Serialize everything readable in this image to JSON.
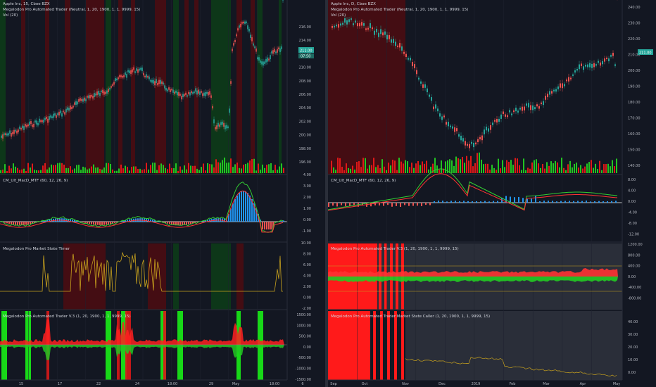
{
  "left": {
    "title": "Apple Inc, 15, Cboe BZX",
    "indicator_line": "Megalodon Pro Automated Trader (Neutral, 1, 20, 1900, 1, 1, 9999, 15)",
    "vol_label": "Vol (20)",
    "price_axis": [
      "216.00",
      "214.00",
      "212.00",
      "210.00",
      "208.00",
      "206.00",
      "204.00",
      "202.00",
      "200.00",
      "198.00",
      "196.00"
    ],
    "price_tag": "211.00",
    "price_tag2": "07:50",
    "macd_label": "CM_Ult_MacD_MTF (60, 12, 26, 9)",
    "macd_axis": [
      "4.00",
      "3.00",
      "2.00",
      "1.00",
      "0.00",
      "-1.00"
    ],
    "timer_label": "Megalodon Pro Market State Timer",
    "timer_axis": [
      "10.00",
      "8.00",
      "6.00",
      "4.00",
      "2.00",
      "0.00",
      "-2.00"
    ],
    "trader_label": "Megalodon Pro Automated Trader V.3 (1, 20, 1900, 1, 1, 9999, 15)",
    "trader_axis": [
      "1500.00",
      "1000.00",
      "500.00",
      "0.00",
      "-500.00",
      "-1000.00",
      "-1500.00"
    ],
    "time_axis": [
      "15",
      "17",
      "22",
      "24",
      "18:00",
      "29",
      "May",
      "18:00",
      "6"
    ]
  },
  "right": {
    "title": "Apple Inc, D, Cboe BZX",
    "indicator_line": "Megalodon Pro Automated Trader (Neutral, 1, 20, 1900, 1, 1, 9999, 15)",
    "vol_label": "Vol (20)",
    "price_axis": [
      "240.00",
      "230.00",
      "220.00",
      "210.00",
      "200.00",
      "190.00",
      "180.00",
      "170.00",
      "160.00",
      "150.00",
      "140.00"
    ],
    "price_tag": "211.00",
    "macd_label": "CM_Ult_MacD_MTF (60, 12, 26, 9)",
    "macd_axis": [
      "8.00",
      "4.00",
      "0.00",
      "-4.00",
      "-8.00",
      "-12.00"
    ],
    "trader_label": "Megalodon Pro Automated Trader V.3 (1, 20, 1900, 1, 1, 9999, 15)",
    "trader_axis": [
      "1200.00",
      "800.00",
      "400.00",
      "0.00",
      "-400.00",
      "-800.00"
    ],
    "caller_label": "Megalodon Pro Automated Trader Market State Caller (1, 20, 1900, 1, 1, 9999, 15)",
    "caller_axis": [
      "40.00",
      "30.00",
      "20.00",
      "10.00",
      "0.00"
    ],
    "time_axis": [
      "Sep",
      "Oct",
      "Nov",
      "Dec",
      "2019",
      "Feb",
      "Mar",
      "Apr",
      "May"
    ]
  },
  "colors": {
    "background": "#131722",
    "grid": "#1e2230",
    "up": "#26a69a",
    "down": "#ef5350",
    "green_band": "#1b5e20",
    "red_band": "#7f0000",
    "volume_green": "#22c522",
    "volume_red": "#e01818",
    "macd_green": "#33cc33",
    "macd_red": "#ff3333",
    "hist_blue": "#2196f3",
    "timer_line": "#c8a21e",
    "tag_bg": "#26a69a"
  }
}
